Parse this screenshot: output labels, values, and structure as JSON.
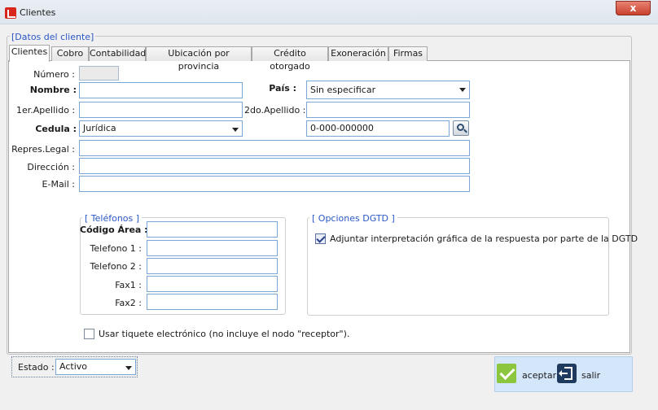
{
  "window": {
    "title": "Clientes",
    "close_label": "x"
  },
  "group": {
    "label": "[Datos del cliente]"
  },
  "tabs": [
    "Clientes",
    "Cobro",
    "Contabilidad",
    "Ubicación por provincia",
    "Crédito otorgado",
    "Exoneración",
    "Firmas"
  ],
  "form": {
    "numero": {
      "label": "Número :",
      "value": ""
    },
    "nombre": {
      "label": "Nombre :",
      "value": ""
    },
    "pais": {
      "label": "País :",
      "value": "Sin especificar"
    },
    "apellido1": {
      "label": "1er.Apellido :",
      "value": ""
    },
    "apellido2": {
      "label": "2do.Apellido :",
      "value": ""
    },
    "cedula": {
      "label": "Cedula :",
      "type": "Jurídica",
      "value": "0-000-000000"
    },
    "repres": {
      "label": "Repres.Legal :",
      "value": ""
    },
    "direccion": {
      "label": "Dirección :",
      "value": ""
    },
    "email": {
      "label": "E-Mail :",
      "value": ""
    }
  },
  "telefonos": {
    "label": "[ Teléfonos ]",
    "codigo_area": "Código Área :",
    "telefono1": "Telefono 1 :",
    "telefono2": "Telefono 2 :",
    "fax1": "Fax1 :",
    "fax2": "Fax2 :"
  },
  "dgtd": {
    "label": "[ Opciones DGTD ]",
    "adjuntar": {
      "label": "Adjuntar interpretación gráfica de la respuesta por parte de la DGTD",
      "checked": true
    }
  },
  "tiquete": {
    "label": "Usar tiquete electrónico (no incluye el nodo \"receptor\").",
    "checked": false
  },
  "estado": {
    "label": "Estado :",
    "value": "Activo"
  },
  "actions": {
    "aceptar": "aceptar",
    "salir": "salir"
  },
  "colors": {
    "accent_blue": "#2a56c6",
    "ok_green": "#8cc63e",
    "exit_navy": "#1e3a5e",
    "close_red": "#c8412e"
  }
}
